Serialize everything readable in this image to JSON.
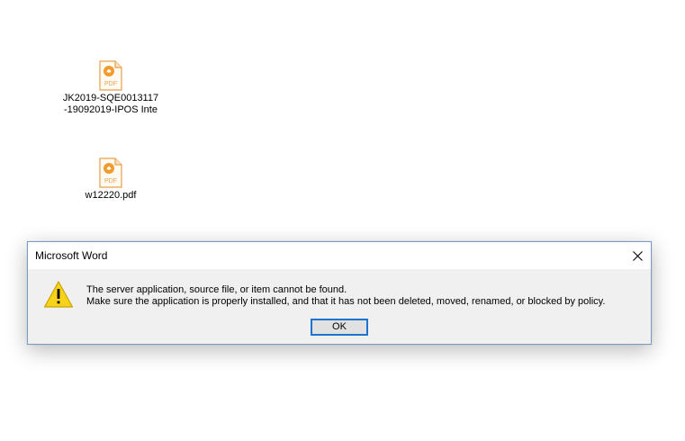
{
  "desktop": {
    "icons": [
      {
        "label": "JK2019-SQE0013117\n-19092019-IPOS Inte",
        "type_badge": "PDF",
        "icon": "pdf-file-icon"
      },
      {
        "label": "w12220.pdf",
        "type_badge": "PDF",
        "icon": "pdf-file-icon"
      }
    ]
  },
  "dialog": {
    "title": "Microsoft Word",
    "close_icon": "close-icon",
    "warning_icon": "warning-icon",
    "message_line1": "The server application, source file, or item cannot be found.",
    "message_line2": "Make sure the application is properly installed, and that it has not been deleted, moved, renamed, or blocked by policy.",
    "ok_label": "OK"
  },
  "colors": {
    "dialog_border": "#7a9cc6",
    "dialog_body": "#f0f0f0",
    "button_focus": "#1e73d0",
    "warning_fill": "#f7d21a",
    "pdf_orange": "#f29b2e"
  }
}
